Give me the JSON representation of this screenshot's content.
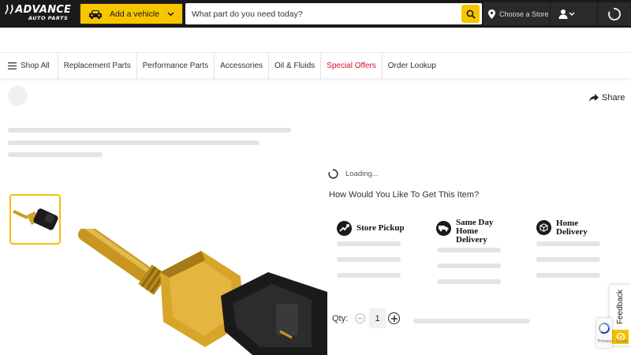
{
  "header": {
    "logo_top": "ADVANCE",
    "logo_bottom": "AUTO PARTS",
    "vehicle_label": "Add a vehicle",
    "search_placeholder": "What part do you need today?",
    "store_label": "Choose a Store",
    "brand_yellow": "#f7c600",
    "bar_color": "#1a1a1a"
  },
  "nav": {
    "shop_all": "Shop All",
    "items": [
      {
        "label": "Replacement Parts"
      },
      {
        "label": "Performance Parts"
      },
      {
        "label": "Accessories"
      },
      {
        "label": "Oil & Fluids"
      },
      {
        "label": "Special Offers",
        "color": "#d40f2a"
      },
      {
        "label": "Order Lookup"
      }
    ]
  },
  "product": {
    "share_label": "Share",
    "loading_text": "Loading...",
    "fulfillment_heading": "How Would You Like To Get This Item?",
    "options": [
      {
        "label_line1": "Store Pickup",
        "label_line2": "",
        "label_line3": "",
        "icon": "store-pickup-icon"
      },
      {
        "label_line1": "Same Day",
        "label_line2": "Home",
        "label_line3": "Delivery",
        "icon": "same-day-truck-icon"
      },
      {
        "label_line1": "Home",
        "label_line2": "Delivery",
        "label_line3": "",
        "icon": "package-icon"
      }
    ],
    "qty_label": "Qty:",
    "qty_value": "1"
  },
  "widgets": {
    "feedback_label": "Feedback",
    "recaptcha_text": "Privacy - Terms"
  }
}
